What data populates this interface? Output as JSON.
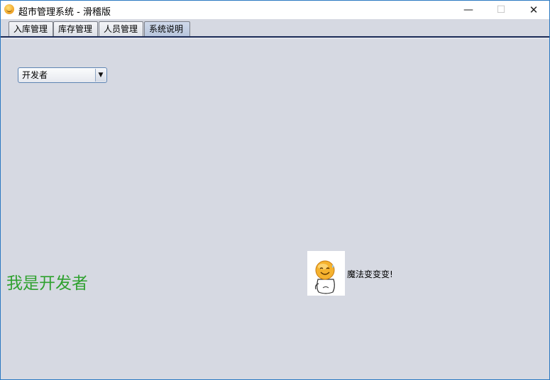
{
  "window": {
    "title": "超市管理系统 - 滑稽版",
    "minimize_glyph": "—",
    "maximize_glyph": "☐",
    "close_glyph": "✕"
  },
  "tabs": [
    {
      "label": "入库管理",
      "selected": false
    },
    {
      "label": "库存管理",
      "selected": false
    },
    {
      "label": "人员管理",
      "selected": false
    },
    {
      "label": "系统说明",
      "selected": true
    }
  ],
  "content": {
    "role_select": {
      "value": "开发者",
      "arrow_glyph": "▼"
    },
    "role_message": "我是开发者",
    "image_caption": "魔法变变变!"
  },
  "colors": {
    "window_bg": "#d6d9e2",
    "message_color": "#2fa12f",
    "border_accent": "#2b79c2"
  },
  "icons": {
    "app": "smiley-face-icon",
    "picture": "funny-face-figure-image"
  }
}
